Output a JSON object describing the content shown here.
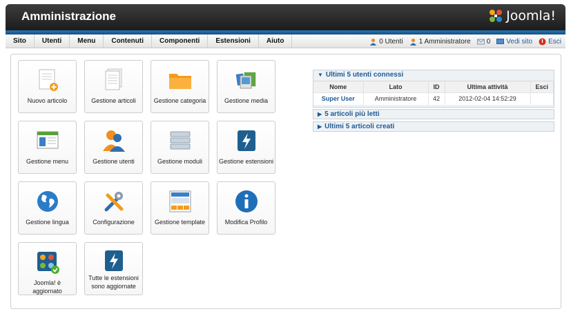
{
  "header": {
    "title": "Amministrazione",
    "logo_text": "Joomla!"
  },
  "menu": [
    "Sito",
    "Utenti",
    "Menu",
    "Contenuti",
    "Componenti",
    "Estensioni",
    "Aiuto"
  ],
  "status": {
    "users": "0 Utenti",
    "admins": "1 Amministratore",
    "messages": "0",
    "view_site": "Vedi sito",
    "logout": "Esci"
  },
  "quickicons": [
    {
      "label": "Nuovo articolo",
      "icon": "new-article-icon"
    },
    {
      "label": "Gestione articoli",
      "icon": "article-manager-icon"
    },
    {
      "label": "Gestione categoria",
      "icon": "category-folder-icon"
    },
    {
      "label": "Gestione media",
      "icon": "media-manager-icon"
    },
    {
      "label": "Gestione menu",
      "icon": "menu-manager-icon"
    },
    {
      "label": "Gestione utenti",
      "icon": "users-icon"
    },
    {
      "label": "Gestione moduli",
      "icon": "modules-icon"
    },
    {
      "label": "Gestione estensioni",
      "icon": "extensions-icon"
    },
    {
      "label": "Gestione lingua",
      "icon": "globe-icon"
    },
    {
      "label": "Configurazione",
      "icon": "tools-icon"
    },
    {
      "label": "Gestione template",
      "icon": "template-icon"
    },
    {
      "label": "Modifica Profilo",
      "icon": "info-icon"
    },
    {
      "label": "Joomla! è aggiornato",
      "icon": "joomla-check-icon"
    },
    {
      "label": "Tutte le estensioni sono aggiornate",
      "icon": "extensions-icon"
    }
  ],
  "panels": {
    "logged": {
      "title": "Ultimi 5 utenti connessi",
      "columns": [
        "Nome",
        "Lato",
        "ID",
        "Ultima attività",
        "Esci"
      ],
      "rows": [
        {
          "name": "Super User",
          "side": "Amministratore",
          "id": "42",
          "last": "2012-02-04 14:52:29",
          "logout": ""
        }
      ]
    },
    "popular": {
      "title": "5 articoli più letti"
    },
    "latest": {
      "title": "Ultimi 5 articoli creati"
    }
  },
  "colors": {
    "header": "#2b2b2b",
    "band": "#1f66a6",
    "link": "#1e5a96"
  }
}
